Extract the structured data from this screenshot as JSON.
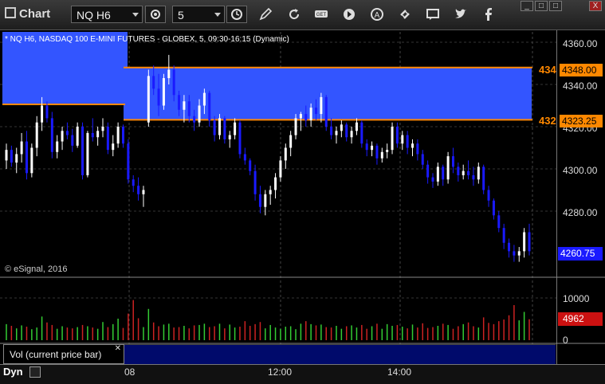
{
  "toolbar": {
    "app_title": "Chart",
    "symbol": "NQ H6",
    "interval": "5"
  },
  "chart": {
    "header": "* NQ H6, NASDAQ 100 E-MINI FUTURES - GLOBEX, 5, 09:30-16:15 (Dynamic)",
    "copyright": "© eSignal, 2016",
    "y_ticks": [
      "4360.00",
      "4340.00",
      "4320.00",
      "4300.00",
      "4280.00"
    ],
    "x_ticks": [
      "08",
      "12:00",
      "14:00"
    ],
    "level_high_label": "4348.00",
    "level_high_stub": "434",
    "level_low_label": "4323.25",
    "level_low_stub": "432",
    "last_price": "4260.75",
    "vol_ticks": [
      "10000",
      "0"
    ],
    "vol_value": "4962",
    "vol_title": "Vol (current price bar)",
    "dyn_label": "Dyn",
    "colors": {
      "up": "#ffffff",
      "down": "#1a1aff",
      "zone": "#3355ff",
      "level": "#ff8800",
      "vol_up": "#33cc33",
      "vol_down": "#cc2222"
    }
  },
  "chart_data": {
    "type": "candlestick",
    "ylim": [
      4253,
      4365
    ],
    "vol_ylim": [
      0,
      14000
    ],
    "bars": [
      {
        "o": 4304,
        "h": 4312,
        "l": 4300,
        "c": 4309
      },
      {
        "o": 4309,
        "h": 4311,
        "l": 4301,
        "c": 4303
      },
      {
        "o": 4303,
        "h": 4310,
        "l": 4298,
        "c": 4307
      },
      {
        "o": 4307,
        "h": 4317,
        "l": 4303,
        "c": 4313
      },
      {
        "o": 4313,
        "h": 4318,
        "l": 4295,
        "c": 4298
      },
      {
        "o": 4298,
        "h": 4312,
        "l": 4296,
        "c": 4310
      },
      {
        "o": 4310,
        "h": 4325,
        "l": 4306,
        "c": 4322
      },
      {
        "o": 4322,
        "h": 4334,
        "l": 4318,
        "c": 4330
      },
      {
        "o": 4330,
        "h": 4332,
        "l": 4322,
        "c": 4324
      },
      {
        "o": 4324,
        "h": 4327,
        "l": 4305,
        "c": 4308
      },
      {
        "o": 4308,
        "h": 4316,
        "l": 4305,
        "c": 4313
      },
      {
        "o": 4313,
        "h": 4320,
        "l": 4309,
        "c": 4318
      },
      {
        "o": 4318,
        "h": 4322,
        "l": 4314,
        "c": 4316
      },
      {
        "o": 4316,
        "h": 4319,
        "l": 4308,
        "c": 4311
      },
      {
        "o": 4311,
        "h": 4322,
        "l": 4310,
        "c": 4320
      },
      {
        "o": 4320,
        "h": 4322,
        "l": 4295,
        "c": 4297
      },
      {
        "o": 4297,
        "h": 4318,
        "l": 4296,
        "c": 4317
      },
      {
        "o": 4317,
        "h": 4324,
        "l": 4313,
        "c": 4315
      },
      {
        "o": 4315,
        "h": 4320,
        "l": 4311,
        "c": 4318
      },
      {
        "o": 4318,
        "h": 4324,
        "l": 4315,
        "c": 4320
      },
      {
        "o": 4320,
        "h": 4322,
        "l": 4307,
        "c": 4309
      },
      {
        "o": 4309,
        "h": 4316,
        "l": 4306,
        "c": 4312
      },
      {
        "o": 4312,
        "h": 4322,
        "l": 4310,
        "c": 4320
      },
      {
        "o": 4320,
        "h": 4321,
        "l": 4310,
        "c": 4312
      },
      {
        "o": 4312,
        "h": 4314,
        "l": 4293,
        "c": 4295
      },
      {
        "o": 4295,
        "h": 4297,
        "l": 4289,
        "c": 4292
      },
      {
        "o": 4292,
        "h": 4296,
        "l": 4285,
        "c": 4288
      },
      {
        "o": 4288,
        "h": 4292,
        "l": 4282,
        "c": 4290
      },
      {
        "o": 4322,
        "h": 4347,
        "l": 4320,
        "c": 4344
      },
      {
        "o": 4344,
        "h": 4349,
        "l": 4335,
        "c": 4338
      },
      {
        "o": 4338,
        "h": 4345,
        "l": 4325,
        "c": 4330
      },
      {
        "o": 4330,
        "h": 4345,
        "l": 4328,
        "c": 4343
      },
      {
        "o": 4343,
        "h": 4354,
        "l": 4340,
        "c": 4347
      },
      {
        "o": 4347,
        "h": 4349,
        "l": 4332,
        "c": 4335
      },
      {
        "o": 4335,
        "h": 4337,
        "l": 4325,
        "c": 4328
      },
      {
        "o": 4328,
        "h": 4335,
        "l": 4322,
        "c": 4332
      },
      {
        "o": 4332,
        "h": 4335,
        "l": 4322,
        "c": 4325
      },
      {
        "o": 4325,
        "h": 4328,
        "l": 4318,
        "c": 4322
      },
      {
        "o": 4322,
        "h": 4333,
        "l": 4320,
        "c": 4330
      },
      {
        "o": 4330,
        "h": 4338,
        "l": 4326,
        "c": 4336
      },
      {
        "o": 4336,
        "h": 4337,
        "l": 4320,
        "c": 4323
      },
      {
        "o": 4323,
        "h": 4325,
        "l": 4313,
        "c": 4316
      },
      {
        "o": 4316,
        "h": 4326,
        "l": 4314,
        "c": 4324
      },
      {
        "o": 4324,
        "h": 4325,
        "l": 4312,
        "c": 4314
      },
      {
        "o": 4314,
        "h": 4318,
        "l": 4310,
        "c": 4316
      },
      {
        "o": 4316,
        "h": 4324,
        "l": 4314,
        "c": 4322
      },
      {
        "o": 4322,
        "h": 4323,
        "l": 4305,
        "c": 4307
      },
      {
        "o": 4307,
        "h": 4310,
        "l": 4302,
        "c": 4304
      },
      {
        "o": 4304,
        "h": 4305,
        "l": 4297,
        "c": 4299
      },
      {
        "o": 4299,
        "h": 4302,
        "l": 4285,
        "c": 4288
      },
      {
        "o": 4288,
        "h": 4292,
        "l": 4279,
        "c": 4282
      },
      {
        "o": 4282,
        "h": 4290,
        "l": 4278,
        "c": 4288
      },
      {
        "o": 4288,
        "h": 4292,
        "l": 4283,
        "c": 4290
      },
      {
        "o": 4290,
        "h": 4298,
        "l": 4286,
        "c": 4296
      },
      {
        "o": 4296,
        "h": 4306,
        "l": 4294,
        "c": 4304
      },
      {
        "o": 4304,
        "h": 4312,
        "l": 4300,
        "c": 4310
      },
      {
        "o": 4310,
        "h": 4318,
        "l": 4306,
        "c": 4316
      },
      {
        "o": 4316,
        "h": 4326,
        "l": 4314,
        "c": 4324
      },
      {
        "o": 4324,
        "h": 4327,
        "l": 4318,
        "c": 4326
      },
      {
        "o": 4326,
        "h": 4330,
        "l": 4320,
        "c": 4323
      },
      {
        "o": 4323,
        "h": 4331,
        "l": 4320,
        "c": 4329
      },
      {
        "o": 4329,
        "h": 4333,
        "l": 4323,
        "c": 4326
      },
      {
        "o": 4326,
        "h": 4336,
        "l": 4322,
        "c": 4334
      },
      {
        "o": 4334,
        "h": 4335,
        "l": 4318,
        "c": 4320
      },
      {
        "o": 4320,
        "h": 4324,
        "l": 4314,
        "c": 4316
      },
      {
        "o": 4316,
        "h": 4320,
        "l": 4312,
        "c": 4318
      },
      {
        "o": 4318,
        "h": 4323,
        "l": 4315,
        "c": 4321
      },
      {
        "o": 4321,
        "h": 4322,
        "l": 4313,
        "c": 4315
      },
      {
        "o": 4315,
        "h": 4320,
        "l": 4312,
        "c": 4318
      },
      {
        "o": 4318,
        "h": 4324,
        "l": 4316,
        "c": 4322
      },
      {
        "o": 4322,
        "h": 4323,
        "l": 4310,
        "c": 4312
      },
      {
        "o": 4312,
        "h": 4314,
        "l": 4306,
        "c": 4309
      },
      {
        "o": 4309,
        "h": 4313,
        "l": 4306,
        "c": 4311
      },
      {
        "o": 4311,
        "h": 4312,
        "l": 4302,
        "c": 4305
      },
      {
        "o": 4305,
        "h": 4310,
        "l": 4303,
        "c": 4308
      },
      {
        "o": 4308,
        "h": 4312,
        "l": 4305,
        "c": 4309
      },
      {
        "o": 4309,
        "h": 4322,
        "l": 4307,
        "c": 4320
      },
      {
        "o": 4320,
        "h": 4322,
        "l": 4310,
        "c": 4312
      },
      {
        "o": 4312,
        "h": 4318,
        "l": 4309,
        "c": 4316
      },
      {
        "o": 4316,
        "h": 4318,
        "l": 4307,
        "c": 4310
      },
      {
        "o": 4310,
        "h": 4314,
        "l": 4306,
        "c": 4312
      },
      {
        "o": 4312,
        "h": 4314,
        "l": 4304,
        "c": 4307
      },
      {
        "o": 4307,
        "h": 4309,
        "l": 4300,
        "c": 4302
      },
      {
        "o": 4302,
        "h": 4304,
        "l": 4293,
        "c": 4296
      },
      {
        "o": 4296,
        "h": 4298,
        "l": 4291,
        "c": 4294
      },
      {
        "o": 4294,
        "h": 4303,
        "l": 4292,
        "c": 4301
      },
      {
        "o": 4301,
        "h": 4302,
        "l": 4292,
        "c": 4295
      },
      {
        "o": 4295,
        "h": 4308,
        "l": 4293,
        "c": 4306
      },
      {
        "o": 4306,
        "h": 4310,
        "l": 4298,
        "c": 4301
      },
      {
        "o": 4301,
        "h": 4303,
        "l": 4294,
        "c": 4297
      },
      {
        "o": 4297,
        "h": 4302,
        "l": 4295,
        "c": 4299
      },
      {
        "o": 4299,
        "h": 4304,
        "l": 4295,
        "c": 4297
      },
      {
        "o": 4297,
        "h": 4301,
        "l": 4292,
        "c": 4295
      },
      {
        "o": 4295,
        "h": 4303,
        "l": 4293,
        "c": 4301
      },
      {
        "o": 4301,
        "h": 4302,
        "l": 4288,
        "c": 4290
      },
      {
        "o": 4290,
        "h": 4292,
        "l": 4282,
        "c": 4285
      },
      {
        "o": 4285,
        "h": 4286,
        "l": 4276,
        "c": 4278
      },
      {
        "o": 4278,
        "h": 4280,
        "l": 4270,
        "c": 4272
      },
      {
        "o": 4272,
        "h": 4274,
        "l": 4262,
        "c": 4265
      },
      {
        "o": 4265,
        "h": 4267,
        "l": 4258,
        "c": 4261
      },
      {
        "o": 4261,
        "h": 4264,
        "l": 4256,
        "c": 4259
      },
      {
        "o": 4259,
        "h": 4263,
        "l": 4256,
        "c": 4261
      },
      {
        "o": 4261,
        "h": 4272,
        "l": 4258,
        "c": 4270
      },
      {
        "o": 4270,
        "h": 4274,
        "l": 4259,
        "c": 4261
      }
    ],
    "volume": [
      3800,
      3400,
      2800,
      3500,
      3200,
      2600,
      3000,
      5600,
      4200,
      3600,
      2700,
      3300,
      3000,
      2800,
      3100,
      3600,
      3300,
      3000,
      2700,
      4300,
      3100,
      3800,
      5100,
      2900,
      6300,
      9500,
      5200,
      3100,
      7400,
      4200,
      3300,
      3700,
      3900,
      3000,
      3100,
      3400,
      2800,
      3500,
      3600,
      3900,
      3100,
      3300,
      3900,
      2800,
      3700,
      3000,
      3200,
      4500,
      3400,
      3800,
      4300,
      2800,
      3600,
      3000,
      2700,
      3200,
      3300,
      2600,
      3900,
      4500,
      3800,
      3500,
      3700,
      3100,
      3000,
      3400,
      2700,
      3300,
      3500,
      3000,
      3600,
      2700,
      3300,
      3900,
      2700,
      3800,
      3400,
      3600,
      3200,
      2800,
      3700,
      3000,
      4000,
      2900,
      3100,
      3400,
      3900,
      3600,
      2700,
      3300,
      3800,
      4200,
      3300,
      3000,
      5400,
      4100,
      3800,
      4500,
      4900,
      5900,
      8300,
      4700,
      6700,
      4962
    ]
  }
}
